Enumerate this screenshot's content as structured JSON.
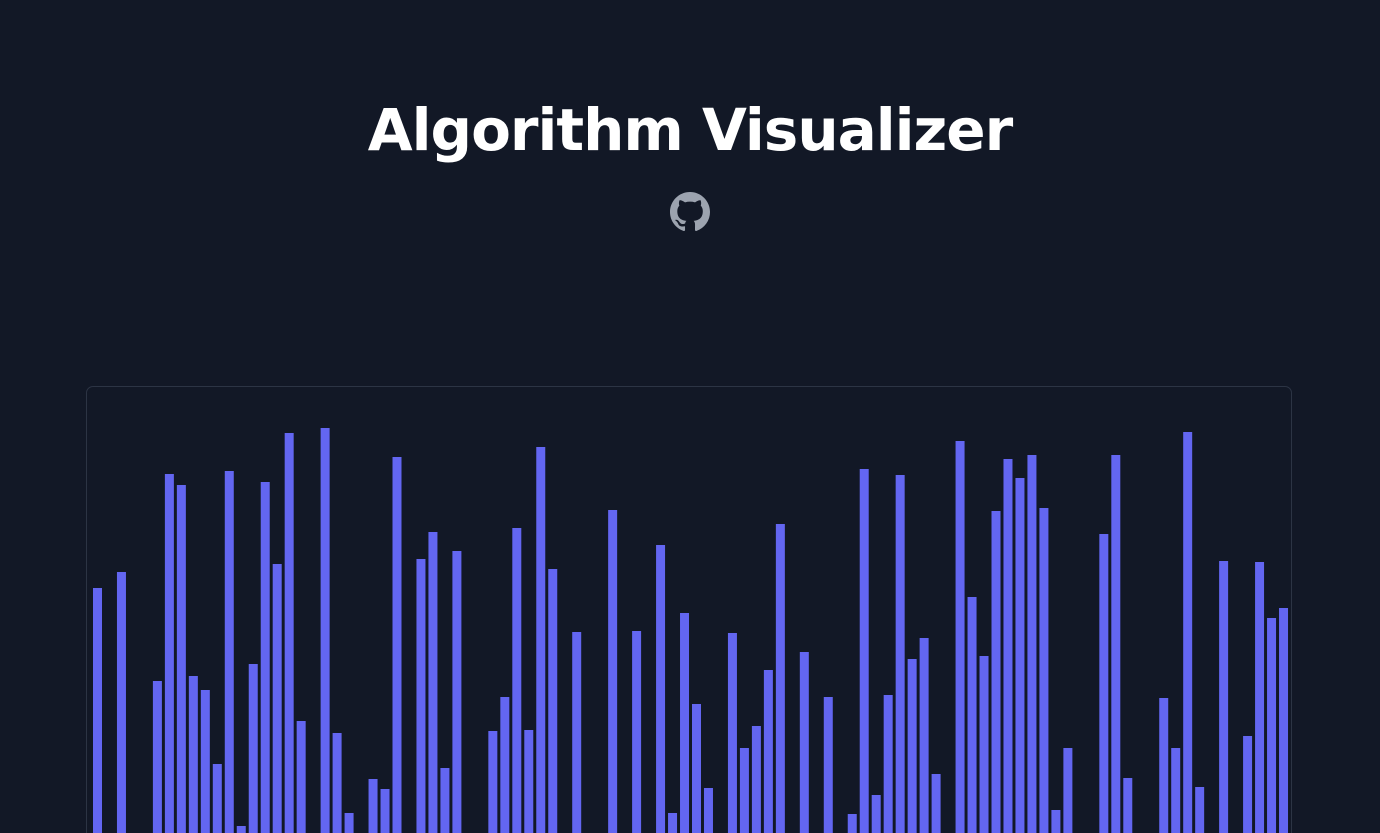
{
  "header": {
    "title": "Algorithm Visualizer",
    "github_icon": "github-icon"
  },
  "colors": {
    "background": "#121826",
    "bar": "#6366f1",
    "panel_border": "#2c3444",
    "title": "#ffffff",
    "icon": "#9ca3af"
  },
  "chart_data": {
    "type": "bar",
    "ylim": [
      0,
      420
    ],
    "values": [
      246,
      0,
      262,
      0,
      0,
      153,
      360,
      349,
      158,
      144,
      70,
      363,
      8,
      170,
      352,
      270,
      401,
      113,
      0,
      406,
      101,
      21,
      0,
      55,
      45,
      377,
      0,
      275,
      302,
      66,
      283,
      0,
      0,
      103,
      137,
      306,
      104,
      387,
      265,
      0,
      202,
      0,
      0,
      324,
      0,
      203,
      0,
      289,
      21,
      221,
      130,
      46,
      0,
      201,
      86,
      108,
      164,
      310,
      0,
      182,
      0,
      137,
      0,
      20,
      365,
      39,
      139,
      359,
      175,
      196,
      60,
      0,
      393,
      237,
      178,
      323,
      375,
      356,
      379,
      326,
      24,
      86,
      0,
      0,
      300,
      379,
      56,
      0,
      0,
      136,
      86,
      402,
      47,
      0,
      273,
      0,
      98,
      272,
      216,
      226,
      68,
      231,
      252
    ]
  }
}
